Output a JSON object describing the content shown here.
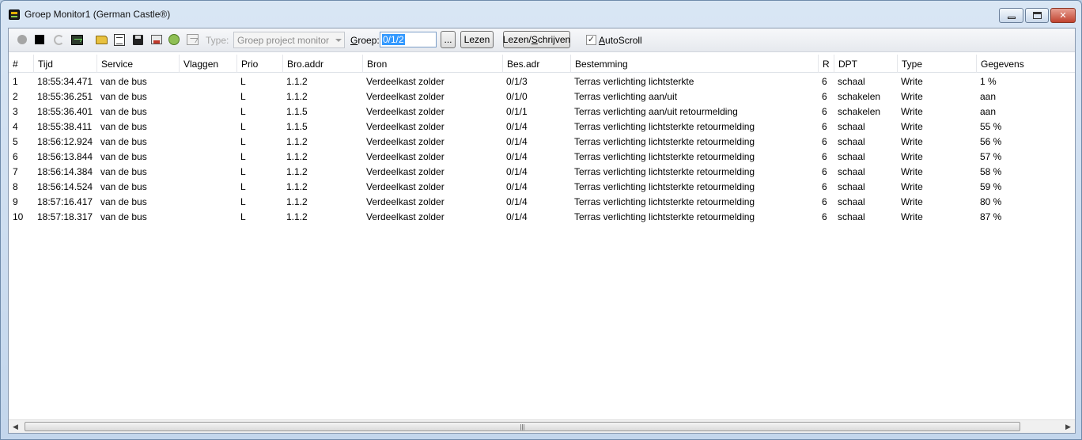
{
  "window": {
    "title": "Groep Monitor1 (German Castle®)"
  },
  "toolbar": {
    "icons": [
      "record-icon",
      "stop-icon",
      "refresh-icon",
      "monitor-icon",
      "open-folder-icon",
      "document-icon",
      "save-icon",
      "print-icon",
      "filter-icon",
      "chart-icon"
    ],
    "type_label": "Type:",
    "type_value": "Groep project monitor",
    "groep_label": "Groep:",
    "groep_value": "0/1/2",
    "browse_label": "...",
    "lezen_label": "Lezen",
    "lezen_schrijven_label": "Lezen/Schrijven",
    "autoscroll_label": "AutoScroll",
    "autoscroll_checked": true
  },
  "table": {
    "columns": [
      "#",
      "Tijd",
      "Service",
      "Vlaggen",
      "Prio",
      "Bro.addr",
      "Bron",
      "Bes.adr",
      "Bestemming",
      "R",
      "DPT",
      "Type",
      "Gegevens"
    ],
    "rows": [
      [
        "1",
        "18:55:34.471",
        "van de bus",
        "",
        "L",
        "1.1.2",
        "Verdeelkast zolder",
        "0/1/3",
        "Terras verlichting lichtsterkte",
        "6",
        "schaal",
        "Write",
        "1 %"
      ],
      [
        "2",
        "18:55:36.251",
        "van de bus",
        "",
        "L",
        "1.1.2",
        "Verdeelkast zolder",
        "0/1/0",
        "Terras verlichting aan/uit",
        "6",
        "schakelen",
        "Write",
        "aan"
      ],
      [
        "3",
        "18:55:36.401",
        "van de bus",
        "",
        "L",
        "1.1.5",
        "Verdeelkast zolder",
        "0/1/1",
        "Terras verlichting aan/uit retourmelding",
        "6",
        "schakelen",
        "Write",
        "aan"
      ],
      [
        "4",
        "18:55:38.411",
        "van de bus",
        "",
        "L",
        "1.1.5",
        "Verdeelkast zolder",
        "0/1/4",
        "Terras verlichting lichtsterkte retourmelding",
        "6",
        "schaal",
        "Write",
        "55 %"
      ],
      [
        "5",
        "18:56:12.924",
        "van de bus",
        "",
        "L",
        "1.1.2",
        "Verdeelkast zolder",
        "0/1/4",
        "Terras verlichting lichtsterkte retourmelding",
        "6",
        "schaal",
        "Write",
        "56 %"
      ],
      [
        "6",
        "18:56:13.844",
        "van de bus",
        "",
        "L",
        "1.1.2",
        "Verdeelkast zolder",
        "0/1/4",
        "Terras verlichting lichtsterkte retourmelding",
        "6",
        "schaal",
        "Write",
        "57 %"
      ],
      [
        "7",
        "18:56:14.384",
        "van de bus",
        "",
        "L",
        "1.1.2",
        "Verdeelkast zolder",
        "0/1/4",
        "Terras verlichting lichtsterkte retourmelding",
        "6",
        "schaal",
        "Write",
        "58 %"
      ],
      [
        "8",
        "18:56:14.524",
        "van de bus",
        "",
        "L",
        "1.1.2",
        "Verdeelkast zolder",
        "0/1/4",
        "Terras verlichting lichtsterkte retourmelding",
        "6",
        "schaal",
        "Write",
        "59 %"
      ],
      [
        "9",
        "18:57:16.417",
        "van de bus",
        "",
        "L",
        "1.1.2",
        "Verdeelkast zolder",
        "0/1/4",
        "Terras verlichting lichtsterkte retourmelding",
        "6",
        "schaal",
        "Write",
        "80 %"
      ],
      [
        "10",
        "18:57:18.317",
        "van de bus",
        "",
        "L",
        "1.1.2",
        "Verdeelkast zolder",
        "0/1/4",
        "Terras verlichting lichtsterkte retourmelding",
        "6",
        "schaal",
        "Write",
        "87 %"
      ]
    ]
  },
  "scrollbar": {
    "left_arrow": "◀",
    "right_arrow": "▶",
    "grip": "|||"
  }
}
